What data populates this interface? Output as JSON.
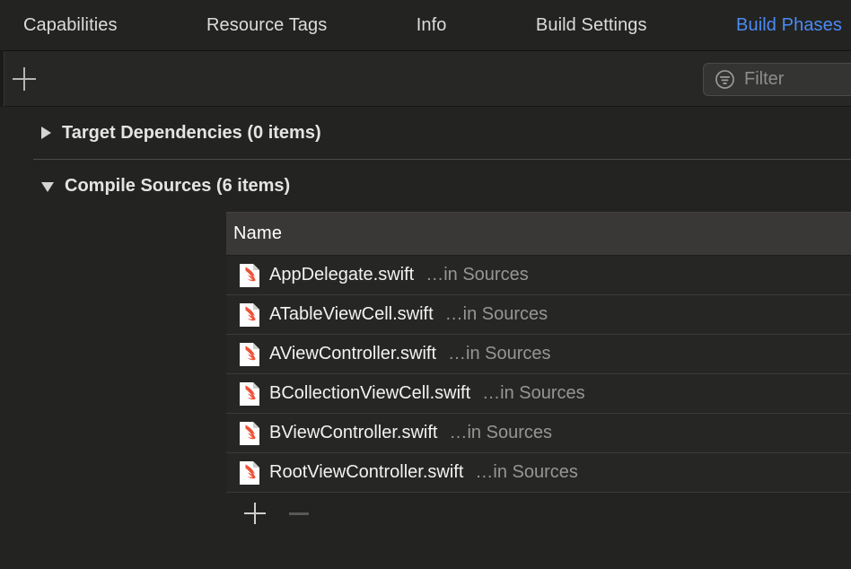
{
  "tabs": [
    {
      "label": "Capabilities",
      "active": false
    },
    {
      "label": "Resource Tags",
      "active": false
    },
    {
      "label": "Info",
      "active": false
    },
    {
      "label": "Build Settings",
      "active": false
    },
    {
      "label": "Build Phases",
      "active": true
    }
  ],
  "toolbar": {
    "add_phase_icon": "plus-icon",
    "filter": {
      "placeholder": "Filter",
      "value": "",
      "icon": "filter-circle-icon"
    }
  },
  "phases": [
    {
      "title": "Target Dependencies (0 items)",
      "expanded": false,
      "disclosure_icon": "triangle-right-icon"
    },
    {
      "title": "Compile Sources (6 items)",
      "expanded": true,
      "disclosure_icon": "triangle-down-icon"
    }
  ],
  "table": {
    "columns": [
      "Name"
    ],
    "rows": [
      {
        "icon": "swift-file-icon",
        "name": "AppDelegate.swift",
        "location": "…in Sources"
      },
      {
        "icon": "swift-file-icon",
        "name": "ATableViewCell.swift",
        "location": "…in Sources"
      },
      {
        "icon": "swift-file-icon",
        "name": "AViewController.swift",
        "location": "…in Sources"
      },
      {
        "icon": "swift-file-icon",
        "name": "BCollectionViewCell.swift",
        "location": "…in Sources"
      },
      {
        "icon": "swift-file-icon",
        "name": "BViewController.swift",
        "location": "…in Sources"
      },
      {
        "icon": "swift-file-icon",
        "name": "RootViewController.swift",
        "location": "…in Sources"
      }
    ],
    "footer": {
      "add_icon": "plus-icon",
      "remove_icon": "minus-icon",
      "remove_enabled": false
    }
  },
  "colors": {
    "window_bg": "#232322",
    "toolbar_bg": "#272726",
    "table_bg": "#262625",
    "table_header_bg": "#3a3836",
    "active_tab": "#4b8bf4",
    "text_primary": "#e4e4e2",
    "text_secondary": "#969694",
    "swift_orange": "#f05138"
  }
}
